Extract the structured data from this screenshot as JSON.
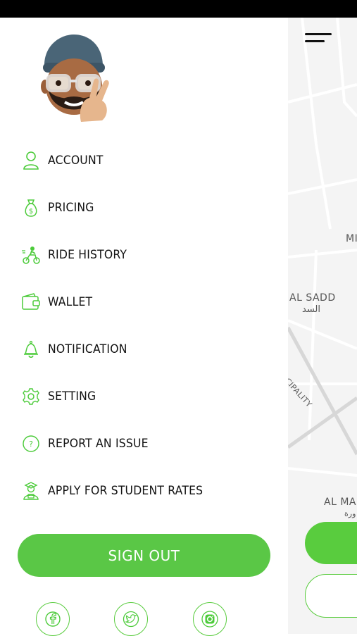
{
  "menu": {
    "items": [
      {
        "label": "ACCOUNT",
        "icon": "user-icon"
      },
      {
        "label": "PRICING",
        "icon": "money-bag-icon"
      },
      {
        "label": "RIDE HISTORY",
        "icon": "scooter-rider-icon"
      },
      {
        "label": "WALLET",
        "icon": "wallet-icon"
      },
      {
        "label": "NOTIFICATION",
        "icon": "bell-icon"
      },
      {
        "label": "SETTING",
        "icon": "gear-icon"
      },
      {
        "label": "REPORT AN ISSUE",
        "icon": "question-icon"
      },
      {
        "label": "APPLY FOR STUDENT RATES",
        "icon": "student-icon"
      }
    ]
  },
  "signout_label": "SIGN OUT",
  "social": [
    "facebook-icon",
    "twitter-icon",
    "instagram-icon"
  ],
  "map": {
    "labels": {
      "al_sadd": "AL SADD",
      "al_sadd_ar": "السد",
      "municipality": "NICIPALITY",
      "mi": "MI",
      "al_ma": "AL MA",
      "al_ma_ar": "ورة"
    }
  },
  "colors": {
    "accent": "#5ac746",
    "icon": "#4ccb3a"
  }
}
